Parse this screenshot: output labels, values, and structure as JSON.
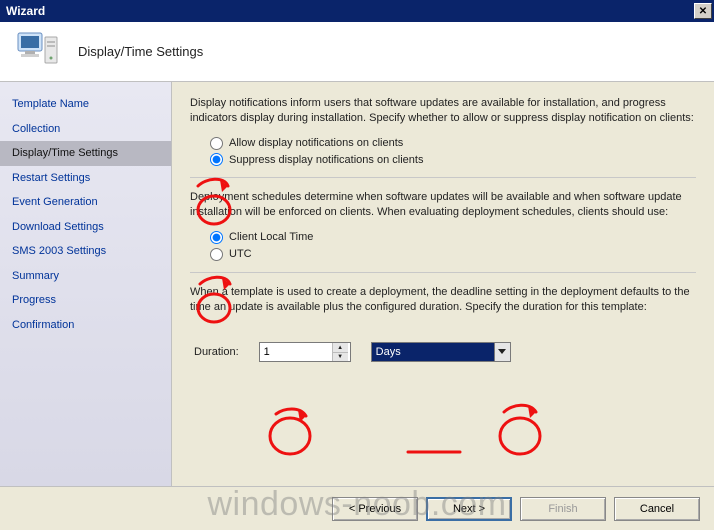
{
  "title": "Wizard",
  "banner": {
    "heading": "Display/Time Settings"
  },
  "sidebar": {
    "items": [
      {
        "label": "Template Name"
      },
      {
        "label": "Collection"
      },
      {
        "label": "Display/Time Settings"
      },
      {
        "label": "Restart Settings"
      },
      {
        "label": "Event Generation"
      },
      {
        "label": "Download Settings"
      },
      {
        "label": "SMS 2003 Settings"
      },
      {
        "label": "Summary"
      },
      {
        "label": "Progress"
      },
      {
        "label": "Confirmation"
      }
    ],
    "active_index": 2
  },
  "main": {
    "intro": "Display notifications inform users that software updates are available for installation, and progress indicators display during installation. Specify whether to allow or suppress display notification on clients:",
    "notif": {
      "allow": "Allow display notifications on clients",
      "suppress": "Suppress display notifications on clients",
      "selected": "suppress"
    },
    "sched_text": "Deployment schedules determine when software updates will be available and when software update installation will be enforced on clients. When evaluating deployment schedules, clients should use:",
    "time": {
      "local": "Client Local Time",
      "utc": "UTC",
      "selected": "local"
    },
    "duration_text": "When a template is used to create a deployment, the deadline setting in the deployment defaults to the time an update is available plus the configured duration. Specify the duration for this template:",
    "duration_label": "Duration:",
    "duration_value": "1",
    "duration_unit": "Days"
  },
  "footer": {
    "previous": "< Previous",
    "next": "Next >",
    "finish": "Finish",
    "cancel": "Cancel"
  },
  "watermark": "windows-noob.com"
}
